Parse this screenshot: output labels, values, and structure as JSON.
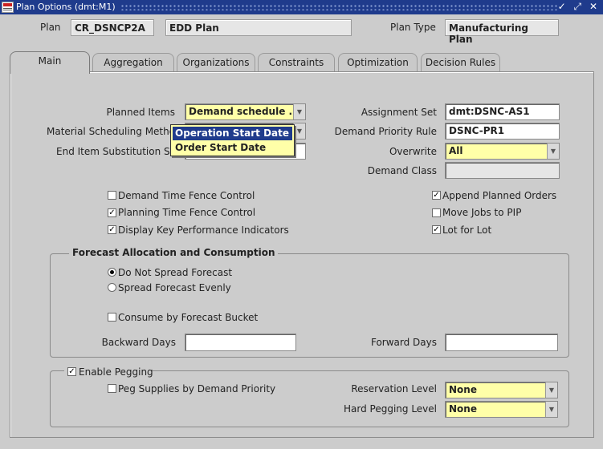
{
  "window": {
    "title": "Plan Options (dmt:M1)",
    "controls": "✓ ⤢ ✕"
  },
  "header": {
    "plan_label": "Plan",
    "plan_value": "CR_DSNCP2A",
    "plan_desc": "EDD Plan",
    "plan_type_label": "Plan Type",
    "plan_type_value": "Manufacturing Plan"
  },
  "tabs": [
    {
      "label": "Main"
    },
    {
      "label": "Aggregation"
    },
    {
      "label": "Organizations"
    },
    {
      "label": "Constraints"
    },
    {
      "label": "Optimization"
    },
    {
      "label": "Decision Rules"
    }
  ],
  "main": {
    "planned_items_label": "Planned Items",
    "planned_items_value": "Demand schedule ...",
    "material_scheduling_label": "Material Scheduling Metho",
    "end_item_label": "End Item Substitution Se",
    "dropdown_options": [
      "Operation Start Date",
      "Order Start Date"
    ],
    "assignment_set_label": "Assignment Set",
    "assignment_set_value": "dmt:DSNC-AS1",
    "demand_priority_label": "Demand Priority Rule",
    "demand_priority_value": "DSNC-PR1",
    "overwrite_label": "Overwrite",
    "overwrite_value": "All",
    "demand_class_label": "Demand Class",
    "demand_class_value": "",
    "checkboxes_left": [
      {
        "label": "Demand Time Fence Control",
        "checked": false
      },
      {
        "label": "Planning Time Fence Control",
        "checked": true
      },
      {
        "label": "Display Key Performance Indicators",
        "checked": true
      }
    ],
    "checkboxes_right": [
      {
        "label": "Append Planned Orders",
        "checked": true
      },
      {
        "label": "Move Jobs to PIP",
        "checked": false
      },
      {
        "label": "Lot for Lot",
        "checked": true
      }
    ]
  },
  "forecast": {
    "title": "Forecast Allocation and Consumption",
    "radio1": "Do Not Spread Forecast",
    "radio2": "Spread Forecast Evenly",
    "consume": "Consume by Forecast Bucket",
    "backward_label": "Backward Days",
    "backward_value": "",
    "forward_label": "Forward Days",
    "forward_value": ""
  },
  "pegging": {
    "title": "Enable Pegging",
    "peg_supplies": "Peg Supplies by Demand Priority",
    "reservation_label": "Reservation Level",
    "reservation_value": "None",
    "hard_pegging_label": "Hard Pegging Level",
    "hard_pegging_value": "None"
  }
}
